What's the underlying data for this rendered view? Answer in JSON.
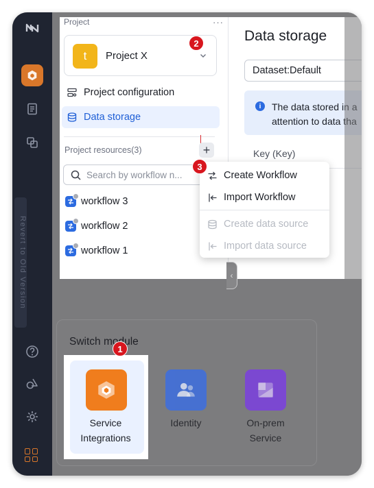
{
  "project_panel": {
    "header": "Project",
    "more": "···",
    "project": {
      "initial": "t",
      "name": "Project X",
      "avatar_color": "#f2b51a"
    },
    "nav": [
      {
        "label": "Project configuration",
        "icon": "settings-sliders-icon",
        "active": false
      },
      {
        "label": "Data storage",
        "icon": "database-icon",
        "active": true
      }
    ],
    "resources_title": "Project resources(3)",
    "add_label": "+",
    "search_placeholder": "Search by workflow n...",
    "workflows": [
      {
        "label": "workflow 3"
      },
      {
        "label": "workflow 2"
      },
      {
        "label": "workflow 1"
      }
    ]
  },
  "create_menu": {
    "items": [
      {
        "label": "Create Workflow",
        "icon": "workflow-create-icon",
        "disabled": false
      },
      {
        "label": "Import Workflow",
        "icon": "import-icon",
        "disabled": false
      },
      {
        "label": "Create data source",
        "icon": "database-icon",
        "disabled": true
      },
      {
        "label": "Import data source",
        "icon": "import-icon",
        "disabled": true
      }
    ]
  },
  "data_storage": {
    "title": "Data storage",
    "dataset_select": "Dataset:Default",
    "info_icon": "i",
    "info_line1": "The data stored in a",
    "info_line2": "attention to data tha",
    "key_column": "Key (Key)"
  },
  "sidebar": {
    "revert_label": "Revert to Old Version"
  },
  "switch_module": {
    "title": "Switch module",
    "modules": [
      {
        "label": "Service\nIntegrations",
        "icon": "service-integrations-icon",
        "color": "#f07d1d",
        "active": true
      },
      {
        "label": "Identity",
        "icon": "identity-icon",
        "color": "#3d6fe0",
        "active": false
      },
      {
        "label": "On-prem\nService",
        "icon": "on-prem-icon",
        "color": "#7b3fe0",
        "active": false
      }
    ]
  },
  "badges": [
    "1",
    "2",
    "3"
  ],
  "colors": {
    "accent": "#2c6be0",
    "badge": "#d8161e",
    "rail": "#1f2431"
  }
}
